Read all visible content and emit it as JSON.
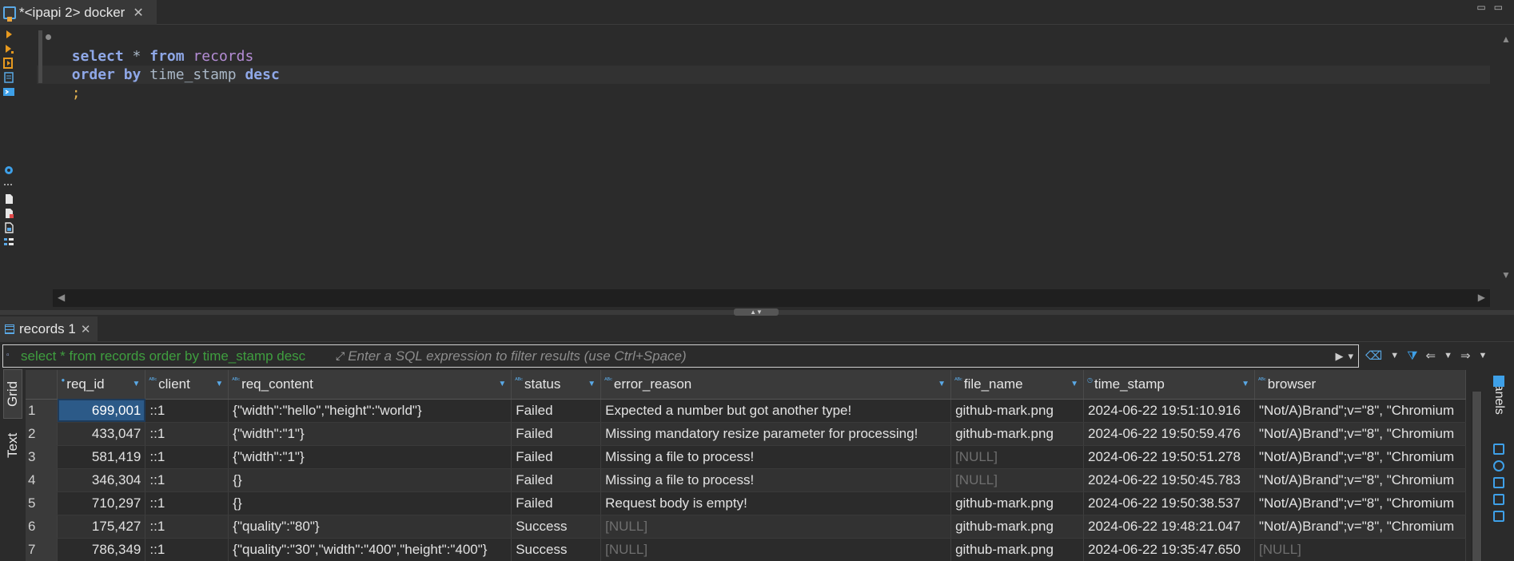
{
  "editor_tab": {
    "title": "*<ipapi 2> docker",
    "close": "✕"
  },
  "sql": {
    "line1": {
      "kw1": "select",
      "sym": " * ",
      "kw2": "from",
      "ident": "records"
    },
    "line2": {
      "kw1": "order by",
      "ident": "time_stamp",
      "kw2": "desc"
    },
    "line3": ";"
  },
  "results_tab": {
    "title": "records 1",
    "close": "✕"
  },
  "filter": {
    "query": "select * from records order by time_stamp desc",
    "placeholder": "Enter a SQL expression to filter results (use Ctrl+Space)"
  },
  "side_tabs": {
    "grid": "Grid",
    "text": "Text"
  },
  "panels_label": "Panels",
  "table": {
    "columns": [
      "req_id",
      "client",
      "req_content",
      "status",
      "error_reason",
      "file_name",
      "time_stamp",
      "browser"
    ],
    "rows": [
      [
        "1",
        "699,001",
        "::1",
        "{\"width\":\"hello\",\"height\":\"world\"}",
        "Failed",
        "Expected a number but got another type!",
        "github-mark.png",
        "2024-06-22 19:51:10.916",
        "\"Not/A)Brand\";v=\"8\", \"Chromium"
      ],
      [
        "2",
        "433,047",
        "::1",
        "{\"width\":\"1\"}",
        "Failed",
        "Missing mandatory resize parameter for processing!",
        "github-mark.png",
        "2024-06-22 19:50:59.476",
        "\"Not/A)Brand\";v=\"8\", \"Chromium"
      ],
      [
        "3",
        "581,419",
        "::1",
        "{\"width\":\"1\"}",
        "Failed",
        "Missing a file to process!",
        "[NULL]",
        "2024-06-22 19:50:51.278",
        "\"Not/A)Brand\";v=\"8\", \"Chromium"
      ],
      [
        "4",
        "346,304",
        "::1",
        "{}",
        "Failed",
        "Missing a file to process!",
        "[NULL]",
        "2024-06-22 19:50:45.783",
        "\"Not/A)Brand\";v=\"8\", \"Chromium"
      ],
      [
        "5",
        "710,297",
        "::1",
        "{}",
        "Failed",
        "Request body is empty!",
        "github-mark.png",
        "2024-06-22 19:50:38.537",
        "\"Not/A)Brand\";v=\"8\", \"Chromium"
      ],
      [
        "6",
        "175,427",
        "::1",
        "{\"quality\":\"80\"}",
        "Success",
        "[NULL]",
        "github-mark.png",
        "2024-06-22 19:48:21.047",
        "\"Not/A)Brand\";v=\"8\", \"Chromium"
      ],
      [
        "7",
        "786,349",
        "::1",
        "{\"quality\":\"30\",\"width\":\"400\",\"height\":\"400\"}",
        "Success",
        "[NULL]",
        "github-mark.png",
        "2024-06-22 19:35:47.650",
        "[NULL]"
      ]
    ]
  },
  "colors": {
    "accent": "#5aa9e6",
    "selection": "#2c5a88",
    "null_text": "#6e6e6e",
    "filter_query": "#3f9e3f"
  }
}
